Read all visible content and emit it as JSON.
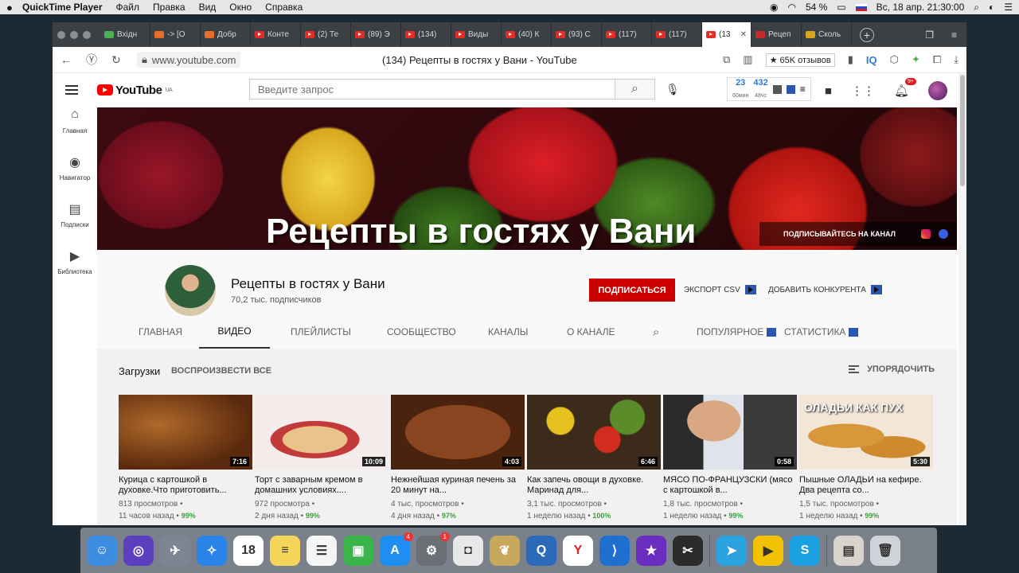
{
  "menubar": {
    "app": "QuickTime Player",
    "items": [
      "Файл",
      "Правка",
      "Вид",
      "Окно",
      "Справка"
    ],
    "battery": "54 %",
    "datetime": "Вс, 18 апр.  21:30:00"
  },
  "tabs": [
    {
      "label": "Вхідн",
      "icon": "green"
    },
    {
      "label": "-> [О",
      "icon": "orange"
    },
    {
      "label": "Добр",
      "icon": "orange"
    },
    {
      "label": "Конте",
      "icon": "yt"
    },
    {
      "label": "(2) Те",
      "icon": "yt"
    },
    {
      "label": "(89) Э",
      "icon": "yt"
    },
    {
      "label": "(134)",
      "icon": "yt"
    },
    {
      "label": "Виды",
      "icon": "yt"
    },
    {
      "label": "(40) К",
      "icon": "yt"
    },
    {
      "label": "(93) С",
      "icon": "yt"
    },
    {
      "label": "(117)",
      "icon": "yt"
    },
    {
      "label": "(117)",
      "icon": "yt"
    },
    {
      "label": "(13",
      "icon": "yt",
      "active": true
    },
    {
      "label": "Рецеп",
      "icon": "chart"
    },
    {
      "label": "Сколь",
      "icon": "yellow"
    }
  ],
  "address": {
    "url": "www.youtube.com",
    "title": "(134) Рецепты в гостях у Вани - YouTube",
    "reviews": "★ 65K отзывов",
    "iq": "IQ"
  },
  "youtube": {
    "logo": "YouTube",
    "region": "UA",
    "search_placeholder": "Введите запрос",
    "stat1_value": "23",
    "stat1_label": "60мин",
    "stat2_value": "432",
    "stat2_label": "48чс",
    "notifications": "9+"
  },
  "sidebar": [
    {
      "label": "Главная",
      "icon": "home-icon",
      "glyph": "⌂"
    },
    {
      "label": "Навигатор",
      "icon": "compass-icon",
      "glyph": "◉"
    },
    {
      "label": "Подписки",
      "icon": "subscriptions-icon",
      "glyph": "▤"
    },
    {
      "label": "Библиотека",
      "icon": "library-icon",
      "glyph": "▶"
    }
  ],
  "banner": {
    "title": "Рецепты в гостях у Вани",
    "subscribe_link": "ПОДПИСЫВАЙТЕСЬ НА КАНАЛ"
  },
  "channel": {
    "name": "Рецепты в гостях у Вани",
    "subscribers": "70,2 тыс. подписчиков",
    "subscribe": "ПОДПИСАТЬСЯ",
    "export_csv": "ЭКСПОРТ CSV",
    "add_competitor": "ДОБАВИТЬ КОНКУРЕНТА",
    "tabs": {
      "home": "ГЛАВНАЯ",
      "videos": "ВИДЕО",
      "playlists": "ПЛЕЙЛИСТЫ",
      "community": "СООБЩЕСТВО",
      "channels": "КАНАЛЫ",
      "about": "О КАНАЛЕ",
      "popular": "ПОПУЛЯРНОЕ",
      "statistics": "СТАТИСТИКА"
    }
  },
  "uploads": {
    "title": "Загрузки",
    "play_all": "ВОСПРОИЗВЕСТИ ВСЕ",
    "sort": "УПОРЯДОЧИТЬ",
    "videos": [
      {
        "title": "Курица с картошкой в духовке.Что приготовить...",
        "duration": "7:16",
        "views": "813 просмотров",
        "age": "11 часов назад",
        "pct": "99%",
        "bg": "radial-gradient(ellipse at 30% 40%, #b06a2a, #5b2a0e 70%), #3a1a08",
        "overlay": ""
      },
      {
        "title": "Торт с заварным кремом в домашних условиях....",
        "duration": "10:09",
        "views": "972 просмотра",
        "age": "2 дня назад",
        "pct": "99%",
        "bg": "radial-gradient(ellipse 60% 45% at 45% 60%, #e9c38a 0 40%, #c23a3a 41% 55%, #f4ecea 56%), #f7f2f0",
        "overlay": ""
      },
      {
        "title": "Нежнейшая куриная печень за 20 минут на...",
        "duration": "4:03",
        "views": "4 тыс. просмотров",
        "age": "4 дня назад",
        "pct": "97%",
        "bg": "radial-gradient(ellipse 65% 60% at 50% 50%, #8a4420 0 60%, #4a230f 61%), #6b5c4f",
        "overlay": ""
      },
      {
        "title": "Как запечь овощи в духовке. Маринад для...",
        "duration": "6:46",
        "views": "3,1 тыс. просмотров",
        "age": "1 неделю назад",
        "pct": "100%",
        "bg": "radial-gradient(circle at 25% 35%, #e5c21f 0 12%, transparent 13%), radial-gradient(circle at 60% 60%, #d12c1d 0 14%, transparent 15%), radial-gradient(circle at 75% 30%, #5b8c2a 0 15%, transparent 16%), #3c2a1a",
        "overlay": ""
      },
      {
        "title": "МЯСО ПО-ФРАНЦУЗСКИ (мясо с картошкой в...",
        "duration": "0:58",
        "views": "1,8 тыс. просмотров",
        "age": "1 неделю назад",
        "pct": "99%",
        "bg": "radial-gradient(ellipse 22% 30% at 38% 35%, #d9a883 0 90%, transparent 92%), linear-gradient(90deg, #2b2b2b 0 30%, #dfe4ec 30% 60%, #3b3b3b 60%)",
        "overlay": ""
      },
      {
        "title": "Пышные ОЛАДЬИ на кефире. Два рецепта со...",
        "duration": "5:30",
        "views": "1,5 тыс. просмотров",
        "age": "1 неделю назад",
        "pct": "99%",
        "bg": "radial-gradient(ellipse 35% 20% at 35% 55%, #d8973a 0 80%, transparent 82%), radial-gradient(ellipse 30% 18% at 70% 70%, #cf8a2f 0 80%, transparent 82%), #f2e6d6",
        "overlay": "ОЛАДЬИ КАК ПУХ"
      }
    ]
  },
  "dock": [
    {
      "name": "finder-icon",
      "color": "#3c8de0",
      "glyph": "☺"
    },
    {
      "name": "siri-icon",
      "color": "#5b3fbf",
      "glyph": "◎"
    },
    {
      "name": "launchpad-icon",
      "color": "#7d8591",
      "glyph": "✈"
    },
    {
      "name": "safari-icon",
      "color": "#2a83e8",
      "glyph": "✧"
    },
    {
      "name": "calendar-icon",
      "color": "#ffffff",
      "glyph": "18",
      "dark": true
    },
    {
      "name": "notes-icon",
      "color": "#f6d65a",
      "glyph": "≡",
      "dark": true
    },
    {
      "name": "reminders-icon",
      "color": "#f4f4f4",
      "glyph": "☰",
      "dark": true
    },
    {
      "name": "facetime-icon",
      "color": "#3ab54a",
      "glyph": "▣"
    },
    {
      "name": "appstore-icon",
      "color": "#1f8ef1",
      "glyph": "A",
      "badge": "4"
    },
    {
      "name": "system-preferences-icon",
      "color": "#6c6f75",
      "glyph": "⚙",
      "badge": "1"
    },
    {
      "name": "screenshot-icon",
      "color": "#e8e8e8",
      "glyph": "◘",
      "dark": true
    },
    {
      "name": "cocktail-icon",
      "color": "#c8a95c",
      "glyph": "❦"
    },
    {
      "name": "quicktime-icon",
      "color": "#2b6ab8",
      "glyph": "Q"
    },
    {
      "name": "yandex-browser-icon",
      "color": "#ffffff",
      "glyph": "Y",
      "red": true
    },
    {
      "name": "vscode-icon",
      "color": "#1f6fd0",
      "glyph": "⟩"
    },
    {
      "name": "imovie-icon",
      "color": "#6a2dbf",
      "glyph": "★"
    },
    {
      "name": "final-cut-icon",
      "color": "#2b2b2b",
      "glyph": "✂"
    },
    {
      "sep": true
    },
    {
      "name": "telegram-icon",
      "color": "#2aa3de",
      "glyph": "➤"
    },
    {
      "name": "cloud-folder-icon",
      "color": "#f2c200",
      "glyph": "▶",
      "dark": true
    },
    {
      "name": "skype-icon",
      "color": "#1aa1e1",
      "glyph": "S"
    },
    {
      "sep": true
    },
    {
      "name": "desktop-folder-icon",
      "color": "#d8d3cc",
      "glyph": "▤",
      "dark": true
    },
    {
      "name": "trash-icon",
      "color": "#cfd2d6",
      "glyph": "🗑",
      "dark": true
    }
  ]
}
